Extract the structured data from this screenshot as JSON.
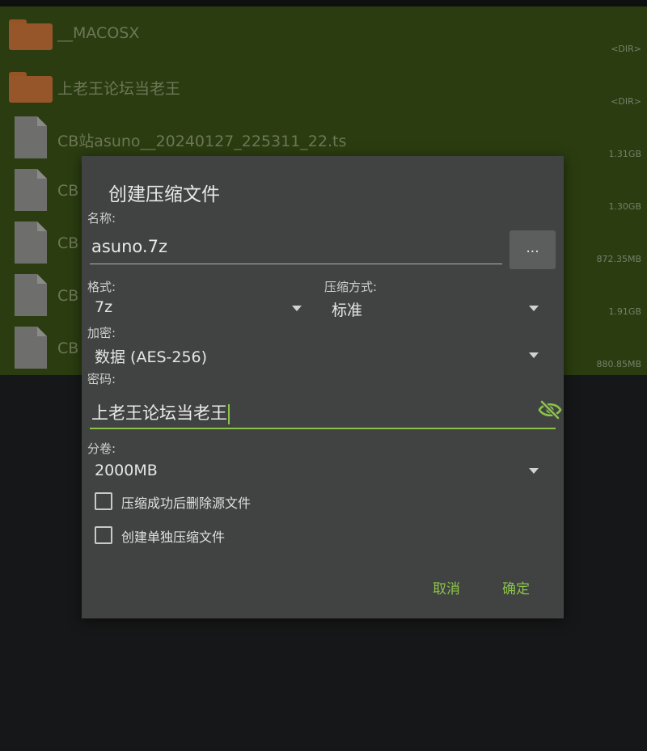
{
  "file_list": {
    "items": [
      {
        "name": "__MACOSX",
        "size": "<DIR>",
        "type": "folder"
      },
      {
        "name": "上老王论坛当老王",
        "size": "<DIR>",
        "type": "folder"
      },
      {
        "name": "CB站asuno__20240127_225311_22.ts",
        "size": "1.31GB",
        "type": "file"
      },
      {
        "name": "CB",
        "size": "1.30GB",
        "type": "file"
      },
      {
        "name": "CB",
        "size": "872.35MB",
        "type": "file"
      },
      {
        "name": "CB",
        "size": "1.91GB",
        "type": "file"
      },
      {
        "name": "CB",
        "size": "880.85MB",
        "type": "file"
      }
    ]
  },
  "dialog": {
    "title": "创建压缩文件",
    "name_label": "名称:",
    "name_value": "asuno.7z",
    "browse_label": "...",
    "format_label": "格式:",
    "format_value": "7z",
    "method_label": "压缩方式:",
    "method_value": "标准",
    "encryption_label": "加密:",
    "encryption_value": "数据 (AES-256)",
    "password_label": "密码:",
    "password_value": "上老王论坛当老王",
    "split_label": "分卷:",
    "split_value": "2000MB",
    "checkbox_delete_label": "压缩成功后删除源文件",
    "checkbox_delete_checked": false,
    "checkbox_separate_label": "创建单独压缩文件",
    "checkbox_separate_checked": false,
    "cancel_label": "取消",
    "ok_label": "确定"
  },
  "colors": {
    "accent": "#8bc34a",
    "dialog_bg": "#414242",
    "list_bg": "#2a3c10",
    "folder": "#97562a"
  }
}
